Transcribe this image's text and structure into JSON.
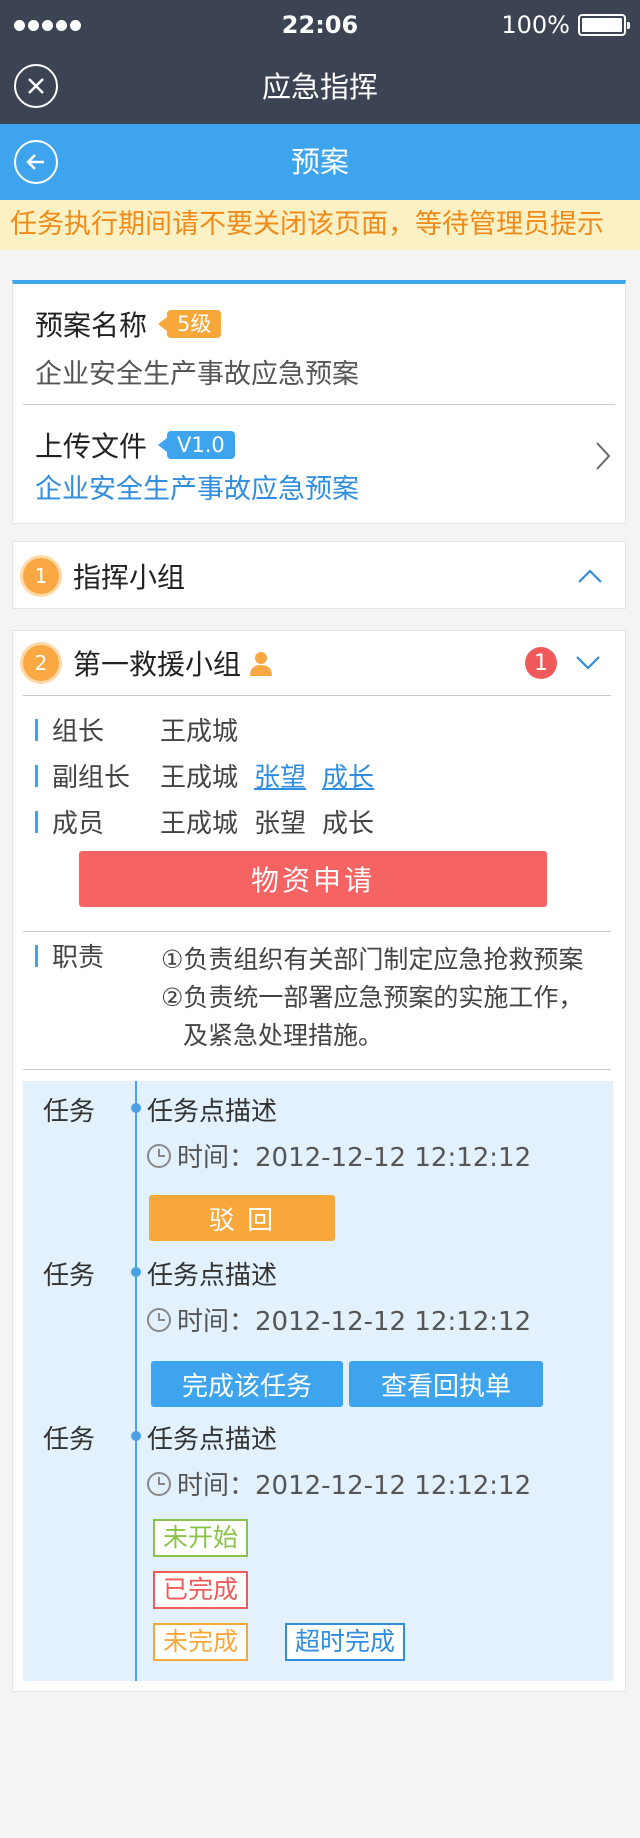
{
  "status_bar": {
    "time": "22:06",
    "battery": "100%"
  },
  "nav": {
    "title": "应急指挥",
    "close_icon": "close-circle-icon"
  },
  "sub_nav": {
    "title": "预案",
    "back_icon": "back-arrow-circle-icon"
  },
  "notice": "任务执行期间请不要关闭该页面，等待管理员提示",
  "plan": {
    "name_label": "预案名称",
    "level": "5级",
    "name": "企业安全生产事故应急预案",
    "upload_label": "上传文件",
    "version": "V1.0",
    "file_name": "企业安全生产事故应急预案"
  },
  "command_group": {
    "index": "1",
    "title": "指挥小组"
  },
  "rescue_group": {
    "index": "2",
    "title": "第一救援小组",
    "badge_count": "1",
    "leader_label": "组长",
    "leader": "王成城",
    "deputy_label": "副组长",
    "deputies": [
      "王成城",
      "张望",
      "成长"
    ],
    "member_label": "成员",
    "members": [
      "王成城",
      "张望",
      "成长"
    ],
    "apply_button": "物资申请",
    "duty_label": "职责",
    "duties": [
      "①负责组织有关部门制定应急抢救预案",
      "②负责统一部署应急预案的实施工作，",
      "及紧急处理措施。"
    ]
  },
  "tasks": [
    {
      "label": "任务",
      "desc": "任务点描述",
      "time": "时间：2012-12-12 12:12:12",
      "reject_button": "驳 回"
    },
    {
      "label": "任务",
      "desc": "任务点描述",
      "time": "时间：2012-12-12 12:12:12",
      "complete_button": "完成该任务",
      "receipt_button": "查看回执单"
    },
    {
      "label": "任务",
      "desc": "任务点描述",
      "time": "时间：2012-12-12 12:12:12",
      "statuses": [
        "未开始",
        "已完成",
        "未完成",
        "超时完成"
      ]
    }
  ],
  "colors": {
    "nav_bg": "#3c4353",
    "accent_blue": "#3ea4ee",
    "orange": "#f8a73b",
    "red": "#f56363",
    "green": "#8bc34a"
  }
}
